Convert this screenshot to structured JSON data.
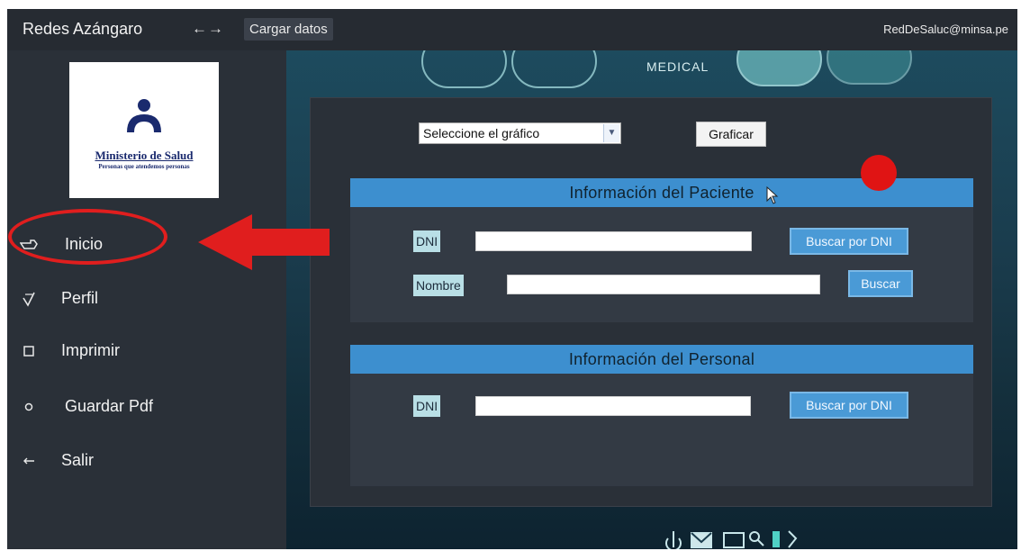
{
  "header": {
    "title": "Redes Azángaro",
    "arrows": "←→",
    "load_button": "Cargar datos",
    "email": "RedDeSaluc@minsa.pe"
  },
  "logo": {
    "name": "Ministerio de Salud",
    "tagline": "Personas que atendemos personas"
  },
  "sidebar": {
    "items": [
      {
        "label": "Inicio",
        "icon": "hand-pointer-icon"
      },
      {
        "label": "Perfil",
        "icon": "check-icon"
      },
      {
        "label": "Imprimir",
        "icon": "square-icon"
      },
      {
        "label": "Guardar Pdf",
        "icon": "circle-icon"
      },
      {
        "label": "Salir",
        "icon": "arrow-left-icon"
      }
    ]
  },
  "background": {
    "medical_tag": "MEDICAL"
  },
  "chart_picker": {
    "selected": "Seleccione el gráfico",
    "button": "Graficar"
  },
  "patient": {
    "title": "Información del Paciente",
    "dni_label": "DNI",
    "dni_value": "",
    "dni_button": "Buscar por DNI",
    "name_label": "Nombre",
    "name_value": "",
    "name_button": "Buscar"
  },
  "staff": {
    "title": "Información del Personal",
    "dni_label": "DNI",
    "dni_value": "",
    "dni_button": "Buscar por DNI"
  },
  "colors": {
    "accent": "#3d8fcf",
    "annotation": "#e01e1e",
    "sidebar_bg": "#2a3038"
  }
}
